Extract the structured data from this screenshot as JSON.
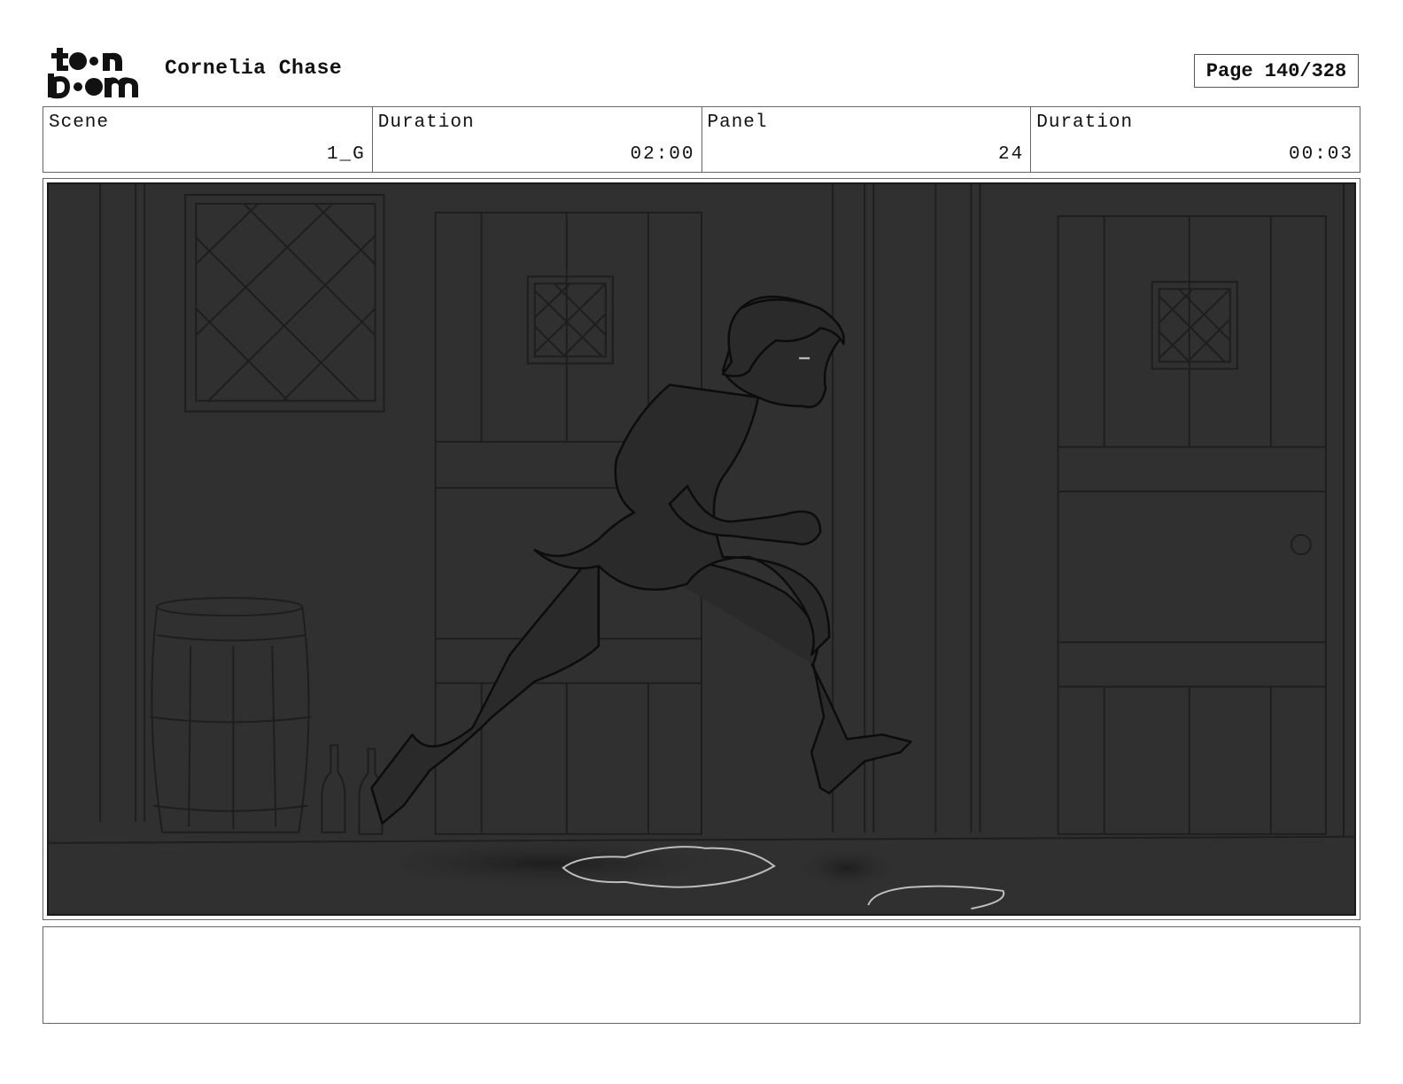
{
  "header": {
    "logo_text": "toon boom",
    "project_title": "Cornelia Chase",
    "page_label": "Page 140/328"
  },
  "info": {
    "scene_label": "Scene",
    "scene_value": "1_G",
    "scene_duration_label": "Duration",
    "scene_duration_value": "02:00",
    "panel_label": "Panel",
    "panel_value": "24",
    "panel_duration_label": "Duration",
    "panel_duration_value": "00:03"
  },
  "notes": {
    "text": ""
  }
}
